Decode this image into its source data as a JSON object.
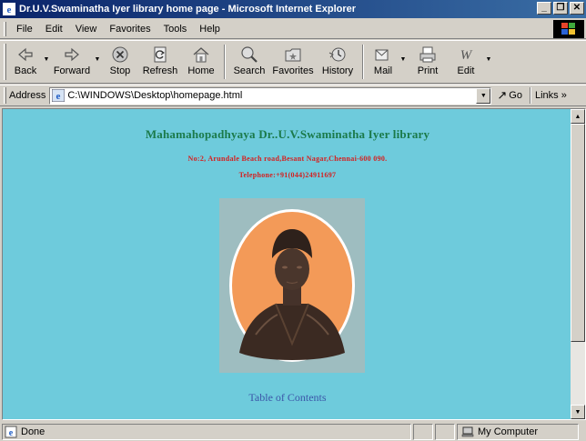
{
  "window": {
    "title": "Dr.U.V.Swaminatha Iyer library home page - Microsoft Internet Explorer",
    "controls": {
      "minimize": "_",
      "maximize": "❐",
      "close": "✕"
    }
  },
  "menu": [
    {
      "id": "file",
      "label": "File"
    },
    {
      "id": "edit",
      "label": "Edit"
    },
    {
      "id": "view",
      "label": "View"
    },
    {
      "id": "favorites",
      "label": "Favorites"
    },
    {
      "id": "tools",
      "label": "Tools"
    },
    {
      "id": "help",
      "label": "Help"
    }
  ],
  "toolbar": {
    "back": "Back",
    "forward": "Forward",
    "stop": "Stop",
    "refresh": "Refresh",
    "home": "Home",
    "search": "Search",
    "favorites": "Favorites",
    "history": "History",
    "mail": "Mail",
    "print": "Print",
    "edit": "Edit"
  },
  "address": {
    "label": "Address",
    "url": "C:\\WINDOWS\\Desktop\\homepage.html",
    "go": "Go",
    "links": "Links »"
  },
  "page": {
    "heading": "Mahamahopadhyaya Dr..U.V.Swaminatha Iyer library",
    "address_line": "No:2, Arundale Beach road,Besant Nagar,Chennai-600 090.",
    "telephone": "Telephone:+91(044)24911697",
    "toc_link": "Table of Contents",
    "colors": {
      "background": "#6ecbdc",
      "heading": "#1b7a4a",
      "address": "#d42020",
      "link": "#3b56a8"
    }
  },
  "status": {
    "text": "Done",
    "zone": "My Computer"
  },
  "icons": [
    "ie-icon",
    "back-arrow-icon",
    "forward-arrow-icon",
    "stop-icon",
    "refresh-icon",
    "home-icon",
    "search-icon",
    "favorites-icon",
    "history-icon",
    "mail-icon",
    "print-icon",
    "edit-icon",
    "windows-logo-icon",
    "computer-icon"
  ]
}
